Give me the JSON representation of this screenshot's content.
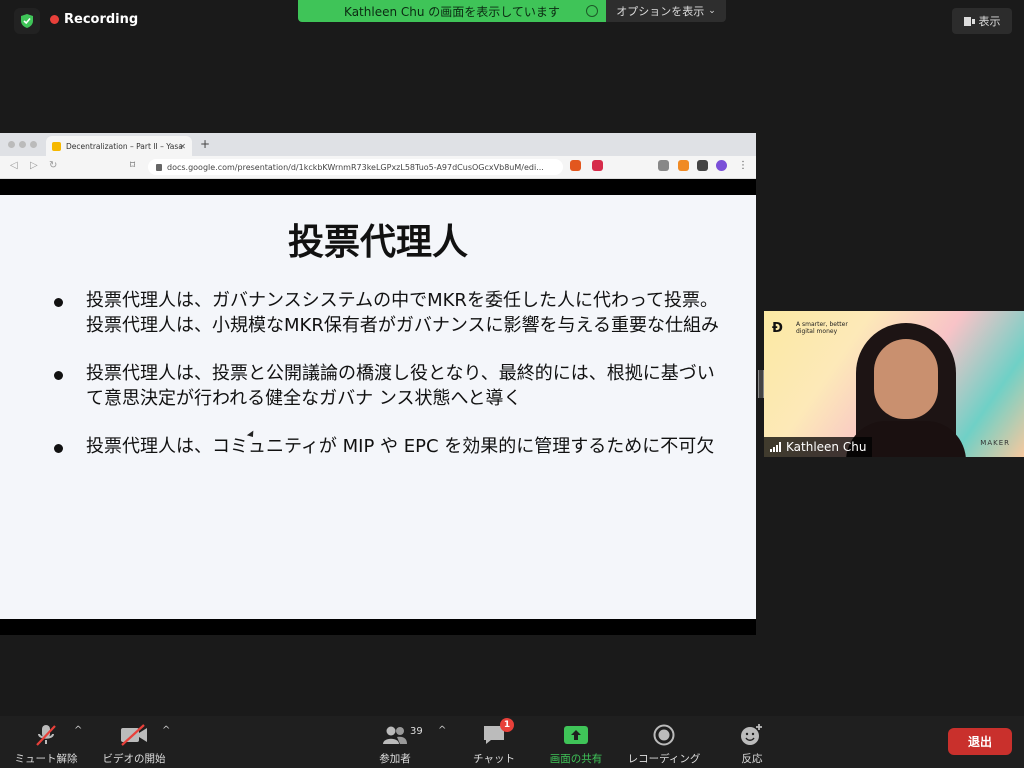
{
  "status": {
    "recording_label": "Recording"
  },
  "share_banner": {
    "text": "Kathleen Chu の画面を表示しています",
    "options_label": "オプションを表示"
  },
  "view_button": {
    "label": "表示"
  },
  "browser": {
    "tab_title": "Decentralization – Part II – Yasa",
    "url": "docs.google.com/presentation/d/1kckbKWrnmR73keLGPxzL58Tuo5-A97dCusOGcxVb8uM/edi..."
  },
  "slide": {
    "title": "投票代理人",
    "bullets": [
      "投票代理人は、ガバナンスシステムの中でMKRを委任した人に代わって投票。投票代理人は、小規模なMKR保有者がガバナンスに影響を与える重要な仕組み",
      "投票代理人は、投票と公開議論の橋渡し役となり、最終的には、根拠に基づいて意思決定が行われる健全なガバナ ンス状態へと導く",
      "投票代理人は、コミュニティが MIP や EPC を効果的に管理するために不可欠"
    ]
  },
  "video": {
    "participant_name": "Kathleen Chu",
    "background_tagline": "A smarter, better digital money",
    "background_brand": "MAKER"
  },
  "toolbar": {
    "mute_label": "ミュート解除",
    "video_label": "ビデオの開始",
    "participants_label": "参加者",
    "participants_count": "39",
    "chat_label": "チャット",
    "chat_badge": "1",
    "share_label": "画面の共有",
    "recording_label": "レコーディング",
    "reactions_label": "反応",
    "end_label": "退出"
  },
  "colors": {
    "share_green": "#3fc458",
    "end_red": "#c9302c",
    "record_red": "#e8403a"
  }
}
